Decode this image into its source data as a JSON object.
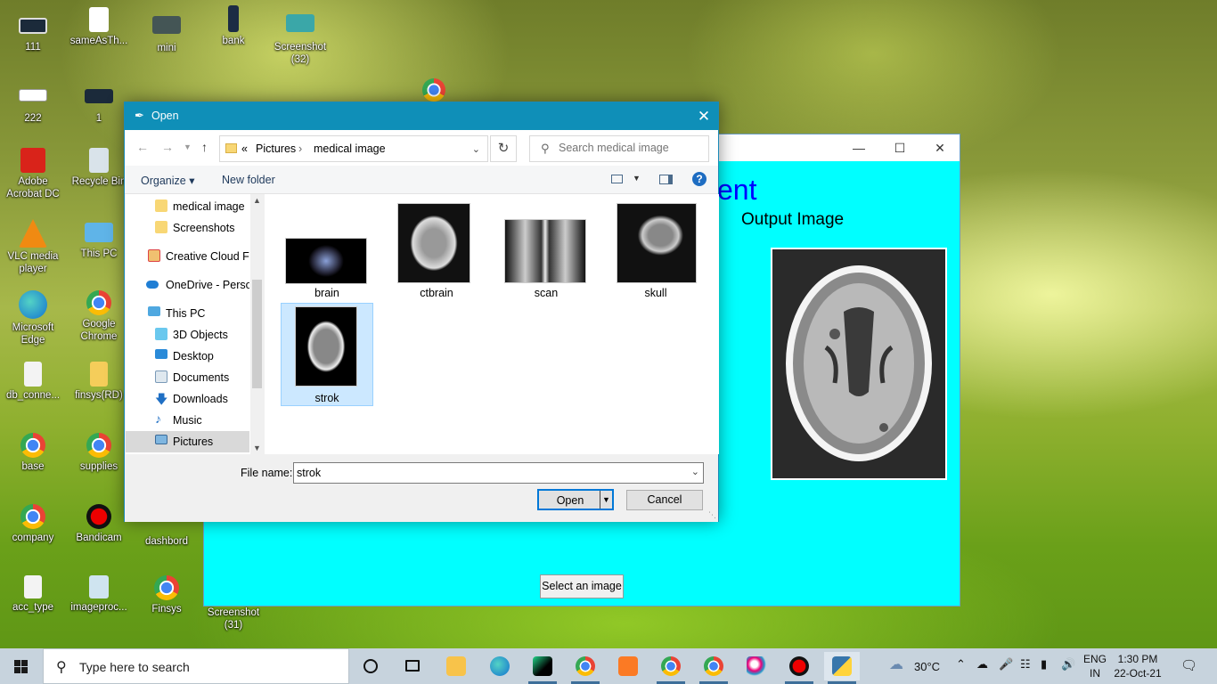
{
  "desktop_icons": [
    {
      "label": "111"
    },
    {
      "label": "sameAsTh..."
    },
    {
      "label": "mini"
    },
    {
      "label": "bank"
    },
    {
      "label": "Screenshot (32)"
    },
    {
      "label": "222"
    },
    {
      "label": "1"
    },
    {
      "label": "Adobe Acrobat DC"
    },
    {
      "label": "Recycle Bin"
    },
    {
      "label": "VLC media player"
    },
    {
      "label": "This PC"
    },
    {
      "label": "Microsoft Edge"
    },
    {
      "label": "Google Chrome"
    },
    {
      "label": "db_conne..."
    },
    {
      "label": "finsys(RD)"
    },
    {
      "label": "base"
    },
    {
      "label": "supplies"
    },
    {
      "label": "company"
    },
    {
      "label": "Bandicam"
    },
    {
      "label": "dashbord"
    },
    {
      "label": "acc_type"
    },
    {
      "label": "imageproc..."
    },
    {
      "label": "Finsys"
    },
    {
      "label": "Screenshot (31)"
    }
  ],
  "app_window": {
    "heading_fragment": "ent",
    "output_label": "Output Image",
    "select_button": "Select an image"
  },
  "dialog": {
    "title": "Open",
    "breadcrumb": [
      "«",
      "Pictures",
      "medical image"
    ],
    "search_placeholder": "Search medical image",
    "commands": {
      "organize": "Organize ▾",
      "new_folder": "New folder"
    },
    "nav_items": [
      {
        "label": "medical image",
        "icon": "folder-icon"
      },
      {
        "label": "Screenshots",
        "icon": "folder-icon"
      },
      {
        "label": "Creative Cloud Fil",
        "icon": "creative-cloud-icon"
      },
      {
        "label": "OneDrive - Persor",
        "icon": "onedrive-icon"
      },
      {
        "label": "This PC",
        "icon": "pc-icon"
      },
      {
        "label": "3D Objects",
        "icon": "cube-icon"
      },
      {
        "label": "Desktop",
        "icon": "desktop-icon"
      },
      {
        "label": "Documents",
        "icon": "documents-icon"
      },
      {
        "label": "Downloads",
        "icon": "download-icon"
      },
      {
        "label": "Music",
        "icon": "music-icon"
      },
      {
        "label": "Pictures",
        "icon": "pictures-icon"
      }
    ],
    "files": [
      {
        "name": "brain"
      },
      {
        "name": "ctbrain"
      },
      {
        "name": "scan"
      },
      {
        "name": "skull"
      },
      {
        "name": "strok"
      }
    ],
    "file_name_label": "File name:",
    "file_name_value": "strok",
    "open_button": "Open",
    "cancel_button": "Cancel"
  },
  "taskbar": {
    "search_text": "Type here to search",
    "weather": "30°C",
    "lang_top": "ENG",
    "lang_bottom": "IN",
    "time": "1:30 PM",
    "date": "22-Oct-21"
  }
}
